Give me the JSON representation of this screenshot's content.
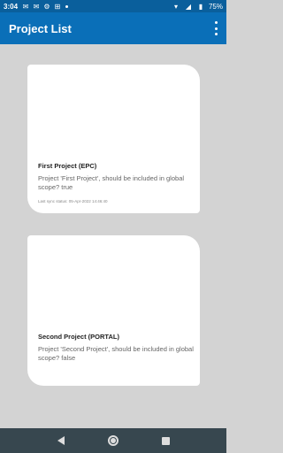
{
  "status_bar": {
    "time": "3:04",
    "battery": "75%",
    "icons": [
      "gmail-icon",
      "mail-icon",
      "settings-icon",
      "grid-icon",
      "wifi-icon",
      "signal-icon",
      "battery-icon"
    ]
  },
  "app_bar": {
    "title": "Project List",
    "menu_icon": "overflow-menu-icon"
  },
  "projects": [
    {
      "title": "First Project (EPC)",
      "description": "Project 'First Project', should be included in global scope? true",
      "sync_status": "Last sync status: 05-Apr-2022 14:46:40"
    },
    {
      "title": "Second Project (PORTAL)",
      "description": "Project 'Second Project', should be included in global scope? false",
      "sync_status": ""
    }
  ],
  "nav_bar": {
    "icons": [
      "back-icon",
      "home-icon",
      "recents-icon"
    ]
  }
}
